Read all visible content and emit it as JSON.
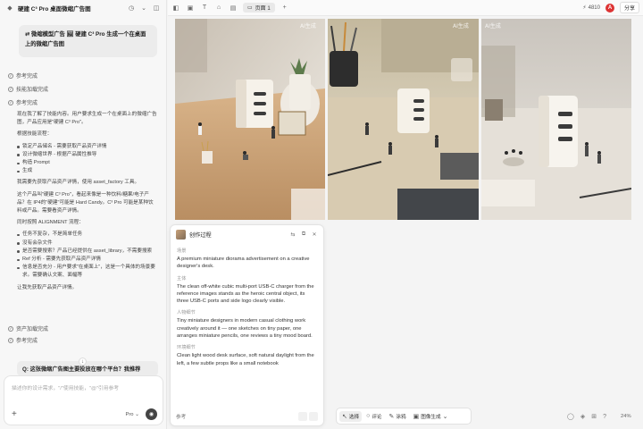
{
  "left": {
    "title": "硬建 C³ Pro 桌面微缩广告图",
    "user_prompt": "⇄ 微缩模型广告  🖼 硬建 C³ Pro  生成一个在桌面上的微缩广告图",
    "statuses": [
      "参考完成",
      "技能加载完成",
      "参考完成"
    ],
    "body": {
      "p1": "现在我了解了技能内容。用户要求生成一个在桌面上的微缩广告图，产品应用是\"硬建 C³ Pro\"。",
      "p2": "根据技能流程：",
      "steps": [
        "锁定产品储名 - 需要获取产品资产详情",
        "设计微缩世界 - 根据产品属性推导",
        "构造 Prompt",
        "生成"
      ],
      "p3": "我需要先获取产品资产详情，使用 asset_factory 工具。",
      "p4": "这个产品叫\"硬建 C³ Pro\"，看起来像是一种饮料/糖果/电子产品？在 IP4的\"硬建\"可能是 Hard Candy。C³ Pro 可能是某种饮料或产品。需要看资产详情。",
      "p5": "同时按照 ALIGNMENT 流程：",
      "checks": [
        "任务不复杂，不是简单任务",
        "没有会杂文件",
        "是否需要搜索？产品已经提供在 asset_library，不需要搜索",
        "Ref 分析 - 需要先获取产品资产详情",
        "信息是否充分 - 用户要求\"在桌面上\"，这是一个具体的场景要求。需要确认文案、面幅等"
      ],
      "p6": "让我先获取产品资产详情。"
    },
    "status_bottom": [
      "资产加载完成",
      "参考完成"
    ],
    "question": "Q: 这张微缩广告图主要投放在哪个平台？我推荐",
    "input_placeholder": "描述你的设计需求，\"/\"使用技能，\"@\"引用参考",
    "model_label": "Pro"
  },
  "topbar": {
    "page_label": "页面 1",
    "credits": "4810",
    "avatar": "A",
    "share_label": "分享"
  },
  "canvas": {
    "watermarks": [
      "AI生成",
      "AI生成",
      "AI生成"
    ]
  },
  "creation": {
    "title": "创作过程",
    "sections": [
      {
        "label": "场景",
        "text": "A premium miniature diorama advertisement on a creative designer's desk."
      },
      {
        "label": "主体",
        "text": "The clean off-white cubic multi-port USB-C charger from the reference images stands as the heroic central object, its three USB-C ports and side logo clearly visible."
      },
      {
        "label": "人物细节",
        "text": "Tiny miniature designers in modern casual clothing work creatively around it — one sketches on tiny paper, one arranges miniature pencils, one reviews a tiny mood board."
      },
      {
        "label": "环境细节",
        "text": "Clean light wood desk surface, soft natural daylight from the left, a few subtle props like a small notebook"
      }
    ],
    "ref_label": "参考"
  },
  "toolbar": {
    "select": "选择",
    "comment": "评论",
    "brush": "涂鸦",
    "generate": "图像生成"
  },
  "zoom": "24%"
}
